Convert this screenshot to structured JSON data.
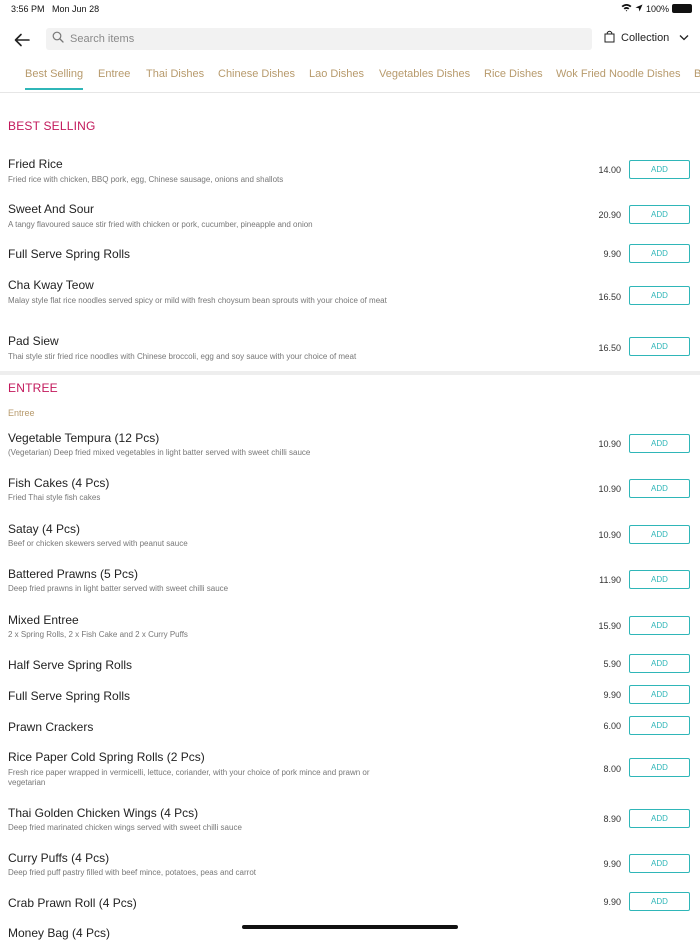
{
  "status": {
    "time": "3:56 PM",
    "date": "Mon Jun 28",
    "battery": "100%"
  },
  "search": {
    "placeholder": "Search items"
  },
  "collection_label": "Collection",
  "tabs": [
    "Best Selling",
    "Entree",
    "Thai Dishes",
    "Chinese Dishes",
    "Lao Dishes",
    "Vegetables Dishes",
    "Rice Dishes",
    "Wok Fried Noodle Dishes",
    "B"
  ],
  "add_label": "ADD",
  "best_selling": {
    "title": "BEST SELLING",
    "items": [
      {
        "name": "Fried Rice",
        "desc": "Fried rice with chicken, BBQ pork, egg, Chinese sausage, onions and shallots",
        "price": "14.00"
      },
      {
        "name": "Sweet And Sour",
        "desc": "A tangy flavoured sauce stir fried with chicken or pork, cucumber, pineapple and onion",
        "price": "20.90"
      },
      {
        "name": "Full Serve Spring Rolls",
        "desc": "",
        "price": "9.90"
      },
      {
        "name": "Cha Kway Teow",
        "desc": "Malay style flat rice noodles served spicy or mild with fresh choysum bean sprouts with your choice of meat",
        "price": "16.50"
      },
      {
        "name": "Pad Siew",
        "desc": "Thai style stir fried rice noodles with Chinese broccoli, egg and soy sauce with your choice of meat",
        "price": "16.50"
      }
    ]
  },
  "entree": {
    "title": "ENTREE",
    "subtitle": "Entree",
    "items": [
      {
        "name": "Vegetable Tempura (12 Pcs)",
        "desc": "(Vegetarian) Deep fried mixed vegetables in light batter served with sweet chilli sauce",
        "price": "10.90"
      },
      {
        "name": "Fish Cakes (4 Pcs)",
        "desc": "Fried Thai style fish cakes",
        "price": "10.90"
      },
      {
        "name": "Satay (4 Pcs)",
        "desc": "Beef or chicken skewers served with peanut sauce",
        "price": "10.90"
      },
      {
        "name": "Battered Prawns (5 Pcs)",
        "desc": "Deep fried prawns in light batter served with sweet chilli sauce",
        "price": "11.90"
      },
      {
        "name": "Mixed Entree",
        "desc": "2 x Spring Rolls, 2 x Fish Cake and 2 x Curry Puffs",
        "price": "15.90"
      },
      {
        "name": "Half Serve Spring Rolls",
        "desc": "",
        "price": "5.90"
      },
      {
        "name": "Full Serve Spring Rolls",
        "desc": "",
        "price": "9.90"
      },
      {
        "name": "Prawn Crackers",
        "desc": "",
        "price": "6.00"
      },
      {
        "name": "Rice Paper Cold Spring Rolls (2 Pcs)",
        "desc": "Fresh rice paper wrapped in vermicelli, lettuce, coriander, with your choice of pork mince and prawn or vegetarian",
        "price": "8.00"
      },
      {
        "name": "Thai Golden Chicken Wings (4 Pcs)",
        "desc": "Deep fried marinated chicken wings served with sweet chilli sauce",
        "price": "8.90"
      },
      {
        "name": "Curry Puffs (4 Pcs)",
        "desc": "Deep fried puff pastry filled with beef mince, potatoes, peas and carrot",
        "price": "9.90"
      },
      {
        "name": "Crab Prawn Roll (4 Pcs)",
        "desc": "",
        "price": "9.90"
      },
      {
        "name": "Money Bag (4 Pcs)",
        "desc": "",
        "price": ""
      }
    ]
  }
}
